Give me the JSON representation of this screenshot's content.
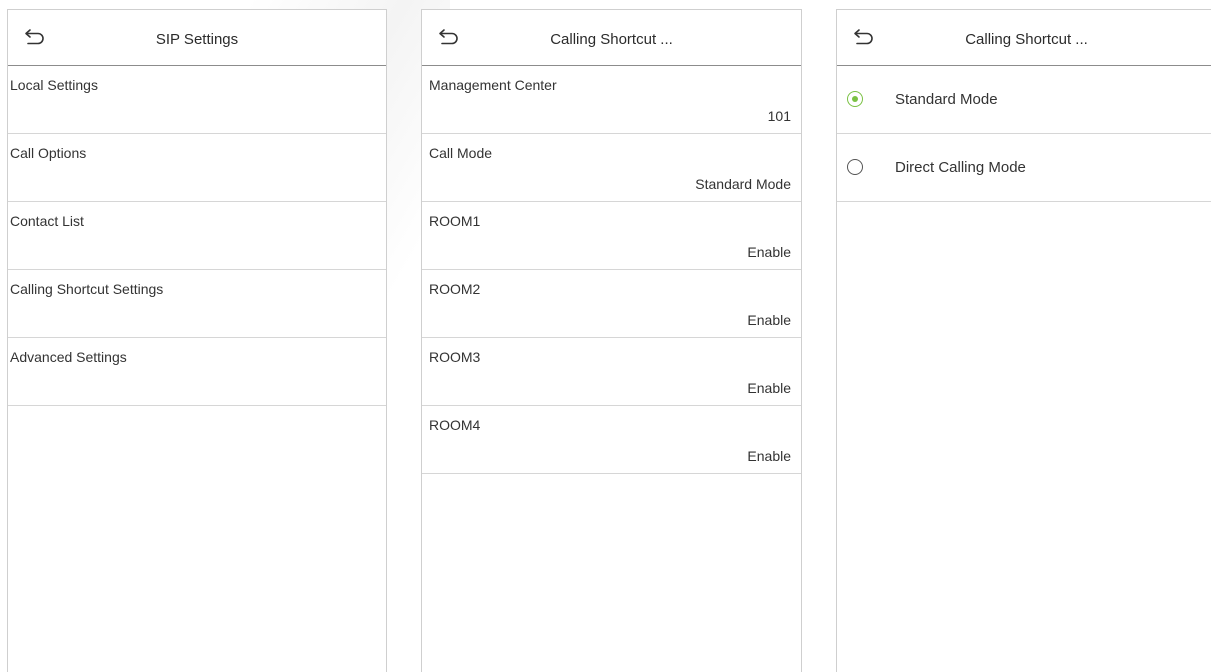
{
  "panel1": {
    "title": "SIP Settings",
    "items": [
      {
        "label": "Local Settings"
      },
      {
        "label": "Call Options"
      },
      {
        "label": "Contact List"
      },
      {
        "label": "Calling Shortcut Settings"
      },
      {
        "label": "Advanced Settings"
      }
    ]
  },
  "panel2": {
    "title": "Calling Shortcut ...",
    "items": [
      {
        "label": "Management Center",
        "value": "101"
      },
      {
        "label": "Call Mode",
        "value": "Standard Mode"
      },
      {
        "label": "ROOM1",
        "value": "Enable"
      },
      {
        "label": "ROOM2",
        "value": "Enable"
      },
      {
        "label": "ROOM3",
        "value": "Enable"
      },
      {
        "label": "ROOM4",
        "value": "Enable"
      }
    ]
  },
  "panel3": {
    "title": "Calling Shortcut ...",
    "options": [
      {
        "label": "Standard Mode",
        "selected": true
      },
      {
        "label": "Direct Calling Mode",
        "selected": false
      }
    ]
  },
  "icons": {
    "back": "back-arrow-icon",
    "radio_selected": "radio-selected-icon",
    "radio_unselected": "radio-unselected-icon"
  },
  "colors": {
    "accent": "#7ac143",
    "header_divider": "#8c8c8c",
    "row_divider": "#d6d6d6",
    "panel_border": "#cfcfcf"
  }
}
